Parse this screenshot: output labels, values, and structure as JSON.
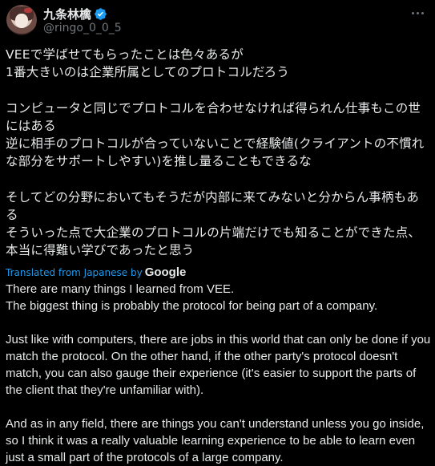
{
  "tweet": {
    "author": {
      "display_name": "九条林檎",
      "handle": "@ringo_0_0_5",
      "verified": true
    },
    "icons": {
      "avatar": "avatar-image",
      "verified": "verified-badge-icon",
      "more": "more-options-icon"
    },
    "colors": {
      "background": "#000000",
      "text": "#e7e9ea",
      "secondary": "#71767b",
      "accent": "#1d9bf0"
    },
    "original_text": "VEEで学ばせてもらったことは色々あるが\n1番大きいのは企業所属としてのプロトコルだろう\n\nコンピュータと同じでプロトコルを合わせなければ得られん仕事もこの世にはある\n逆に相手のプロトコルが合っていないことで経験値(クライアントの不慣れな部分をサポートしやすい)を推し量ることもできるな\n\nそしてどの分野においてもそうだが内部に来てみないと分からん事柄もある\nそういった点で大企業のプロトコルの片端だけでも知ることができた点、本当に得難い学びであったと思う",
    "translation": {
      "label": "Translated from Japanese by",
      "provider": "Google",
      "text": "There are many things I learned from VEE.\nThe biggest thing is probably the protocol for being part of a company.\n\nJust like with computers, there are jobs in this world that can only be done if you match the protocol. On the other hand, if the other party's protocol doesn't match, you can also gauge their experience (it's easier to support the parts of the client that they're unfamiliar with).\n\nAnd as in any field, there are things you can't understand unless you go inside, so I think it was a really valuable learning experience to be able to learn even just a small part of the protocols of a large company."
    }
  }
}
